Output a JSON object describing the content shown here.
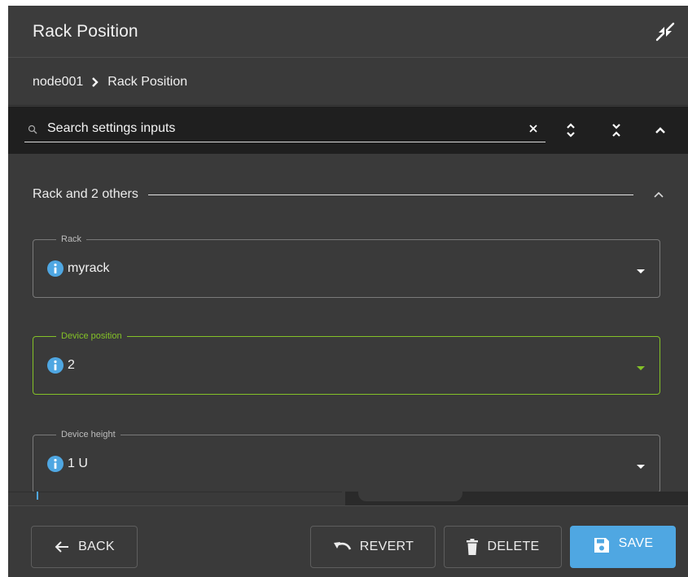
{
  "window": {
    "title": "Rack Position"
  },
  "breadcrumb": {
    "items": [
      "node001",
      "Rack Position"
    ]
  },
  "search": {
    "placeholder": "Search settings inputs",
    "value": ""
  },
  "section": {
    "title": "Rack and 2 others"
  },
  "fields": [
    {
      "label": "Rack",
      "value": "myrack"
    },
    {
      "label": "Device position",
      "value": "2"
    },
    {
      "label": "Device height",
      "value": "1 U"
    }
  ],
  "footer": {
    "back_label": "BACK",
    "revert_label": "REVERT",
    "delete_label": "DELETE",
    "save_label": "SAVE"
  },
  "colors": {
    "accent": "#4fa7e2",
    "active_field": "#84c227",
    "panel_bg": "#3a3a3a",
    "search_bar_bg": "#1f1f1f"
  },
  "icons": {
    "window": "collapse-arrows-icon",
    "breadcrumb_separator": "chevron-right-icon",
    "search": "search-icon",
    "clear": "close-icon",
    "toolbar": [
      "expand-vertical-icon",
      "collapse-vertical-icon",
      "chevron-up-icon"
    ],
    "field_info": "info-icon",
    "field_dropdown": "caret-down-icon",
    "back": "arrow-left-icon",
    "revert": "undo-icon",
    "delete": "trash-icon",
    "save": "floppy-disk-icon"
  }
}
